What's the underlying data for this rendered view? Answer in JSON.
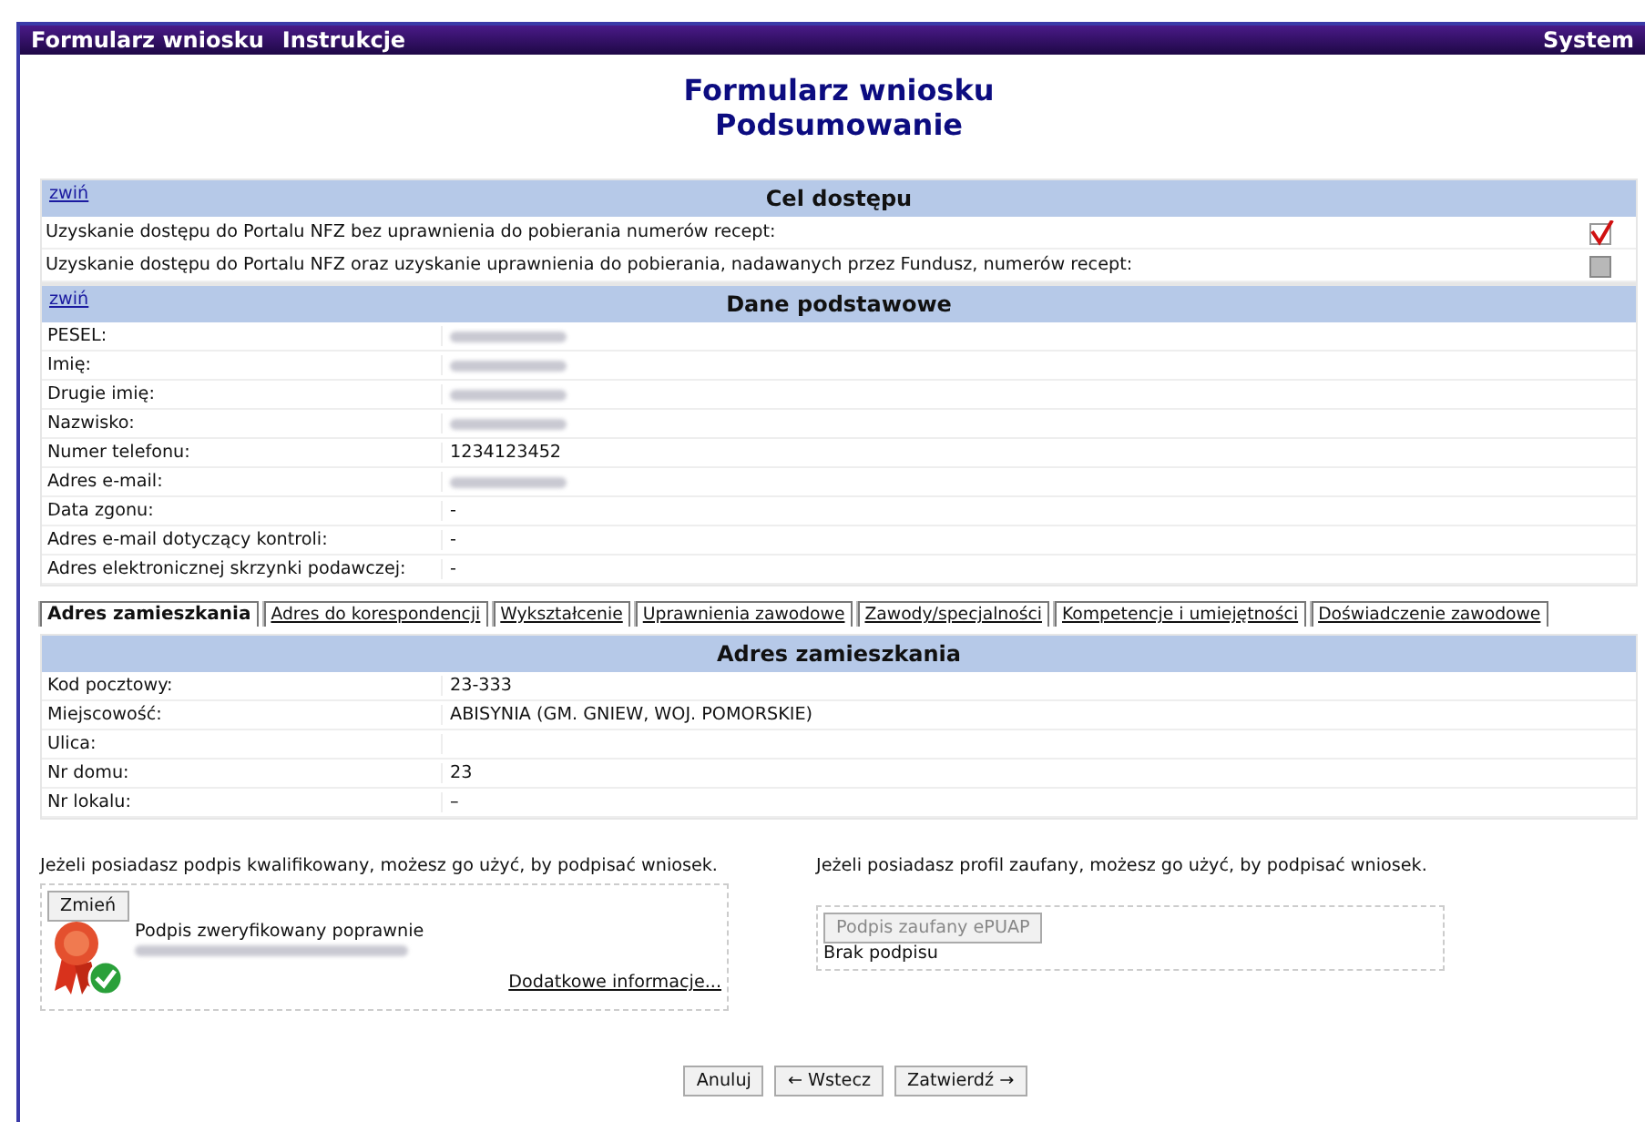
{
  "menu_bar": {
    "items": [
      "Formularz wniosku",
      "Instrukcje"
    ],
    "right": "System"
  },
  "title": [
    "Formularz wniosku",
    "Podsumowanie"
  ],
  "cel_dostepu": {
    "collapse_link": "zwiń",
    "heading": "Cel dostępu",
    "rows": [
      {
        "label": "Uzyskanie dostępu do Portalu NFZ bez uprawnienia do pobierania numerów recept:",
        "checked": true
      },
      {
        "label": "Uzyskanie dostępu do Portalu NFZ oraz uzyskanie uprawnienia do pobierania, nadawanych przez Fundusz, numerów recept:",
        "checked": false
      }
    ]
  },
  "dane_podstawowe": {
    "collapse_link": "zwiń",
    "heading": "Dane podstawowe",
    "rows": [
      {
        "label": "PESEL:",
        "blurred": true
      },
      {
        "label": "Imię:",
        "blurred": true
      },
      {
        "label": "Drugie imię:",
        "blurred": true
      },
      {
        "label": "Nazwisko:",
        "blurred": true
      },
      {
        "label": "Numer telefonu:",
        "value": "1234123452"
      },
      {
        "label": "Adres e-mail:",
        "blurred": true
      },
      {
        "label": "Data zgonu:",
        "value": "-"
      },
      {
        "label": "Adres e-mail dotyczący kontroli:",
        "value": "-"
      },
      {
        "label": "Adres elektronicznej skrzynki podawczej:",
        "value": "-"
      }
    ]
  },
  "tabs": [
    {
      "label": "Adres zamieszkania",
      "selected": true
    },
    {
      "label": "Adres do korespondencji",
      "selected": false
    },
    {
      "label": "Wykształcenie",
      "selected": false
    },
    {
      "label": "Uprawnienia zawodowe",
      "selected": false
    },
    {
      "label": "Zawody/specjalności",
      "selected": false
    },
    {
      "label": "Kompetencje i umiejętności",
      "selected": false
    },
    {
      "label": "Doświadczenie zawodowe",
      "selected": false
    }
  ],
  "adres": {
    "heading": "Adres zamieszkania",
    "rows": [
      {
        "label": "Kod pocztowy:",
        "value": "23-333"
      },
      {
        "label": "Miejscowość:",
        "value": "ABISYNIA (GM. GNIEW, WOJ. POMORSKIE)"
      },
      {
        "label": "Ulica:"
      },
      {
        "label": "Nr domu:",
        "value": "23"
      },
      {
        "label": "Nr lokalu:",
        "value": "–"
      }
    ]
  },
  "qualified_signature": {
    "intro": "Jeżeli posiadasz podpis kwalifikowany, możesz go użyć, by podpisać wniosek.",
    "change_button": "Zmień",
    "status": "Podpis zweryfikowany poprawnie",
    "signer_blurred": true,
    "more_link": "Dodatkowe informacje..."
  },
  "trusted_profile": {
    "intro": "Jeżeli posiadasz profil zaufany, możesz go użyć, by podpisać wniosek.",
    "button": "Podpis zaufany ePUAP",
    "button_disabled": true,
    "status": "Brak podpisu"
  },
  "buttons": [
    "Anuluj",
    "← Wstecz",
    "Zatwierdź →"
  ]
}
